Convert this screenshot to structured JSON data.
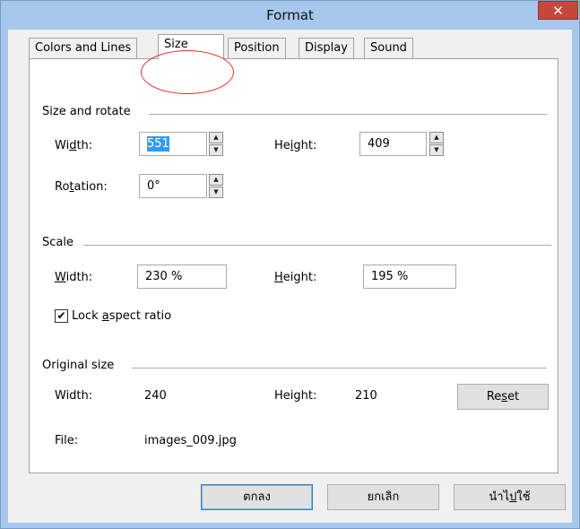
{
  "window": {
    "title": "Format",
    "close_glyph": "✕"
  },
  "tabs": [
    {
      "label": "Colors and Lines",
      "active": false
    },
    {
      "label": "Size",
      "active": true
    },
    {
      "label": "Position",
      "active": false
    },
    {
      "label": "Display",
      "active": false
    },
    {
      "label": "Sound",
      "active": false
    }
  ],
  "size_rotate": {
    "title": "Size and rotate",
    "width_label_pre": "Wi",
    "width_label_mn": "d",
    "width_label_post": "th:",
    "width_value": "551",
    "height_label_pre": "He",
    "height_label_mn": "i",
    "height_label_post": "ght:",
    "height_value": "409",
    "rotation_label_pre": "Ro",
    "rotation_label_mn": "t",
    "rotation_label_post": "ation:",
    "rotation_value": "0°"
  },
  "scale": {
    "title": "Scale",
    "width_label_mn": "W",
    "width_label_post": "idth:",
    "width_value": "230 %",
    "height_label_mn": "H",
    "height_label_post": "eight:",
    "height_value": "195 %",
    "lock_checked": true,
    "lock_label_pre": "Lock ",
    "lock_label_mn": "a",
    "lock_label_post": "spect ratio"
  },
  "original_size": {
    "title": "Original size",
    "width_label": "Width:",
    "width_value": "240",
    "height_label": "Height:",
    "height_value": "210",
    "reset_pre": "Re",
    "reset_mn": "s",
    "reset_post": "et",
    "file_label": "File:",
    "file_value": "images_009.jpg"
  },
  "buttons": {
    "ok": "ตกลง",
    "cancel": "ยกเลิก",
    "apply_pre": "นำไ",
    "apply_mn": "ป",
    "apply_post": "ใช้"
  },
  "spin_up_glyph": "▲",
  "spin_down_glyph": "▼",
  "check_glyph": "✔",
  "colors": {
    "titlebar": "#a6c8ed",
    "close": "#c7473b",
    "selection": "#3399ff",
    "annotation": "#e0322b"
  },
  "icons": [
    "close-icon",
    "spin-up-icon",
    "spin-down-icon",
    "checkmark-icon"
  ]
}
